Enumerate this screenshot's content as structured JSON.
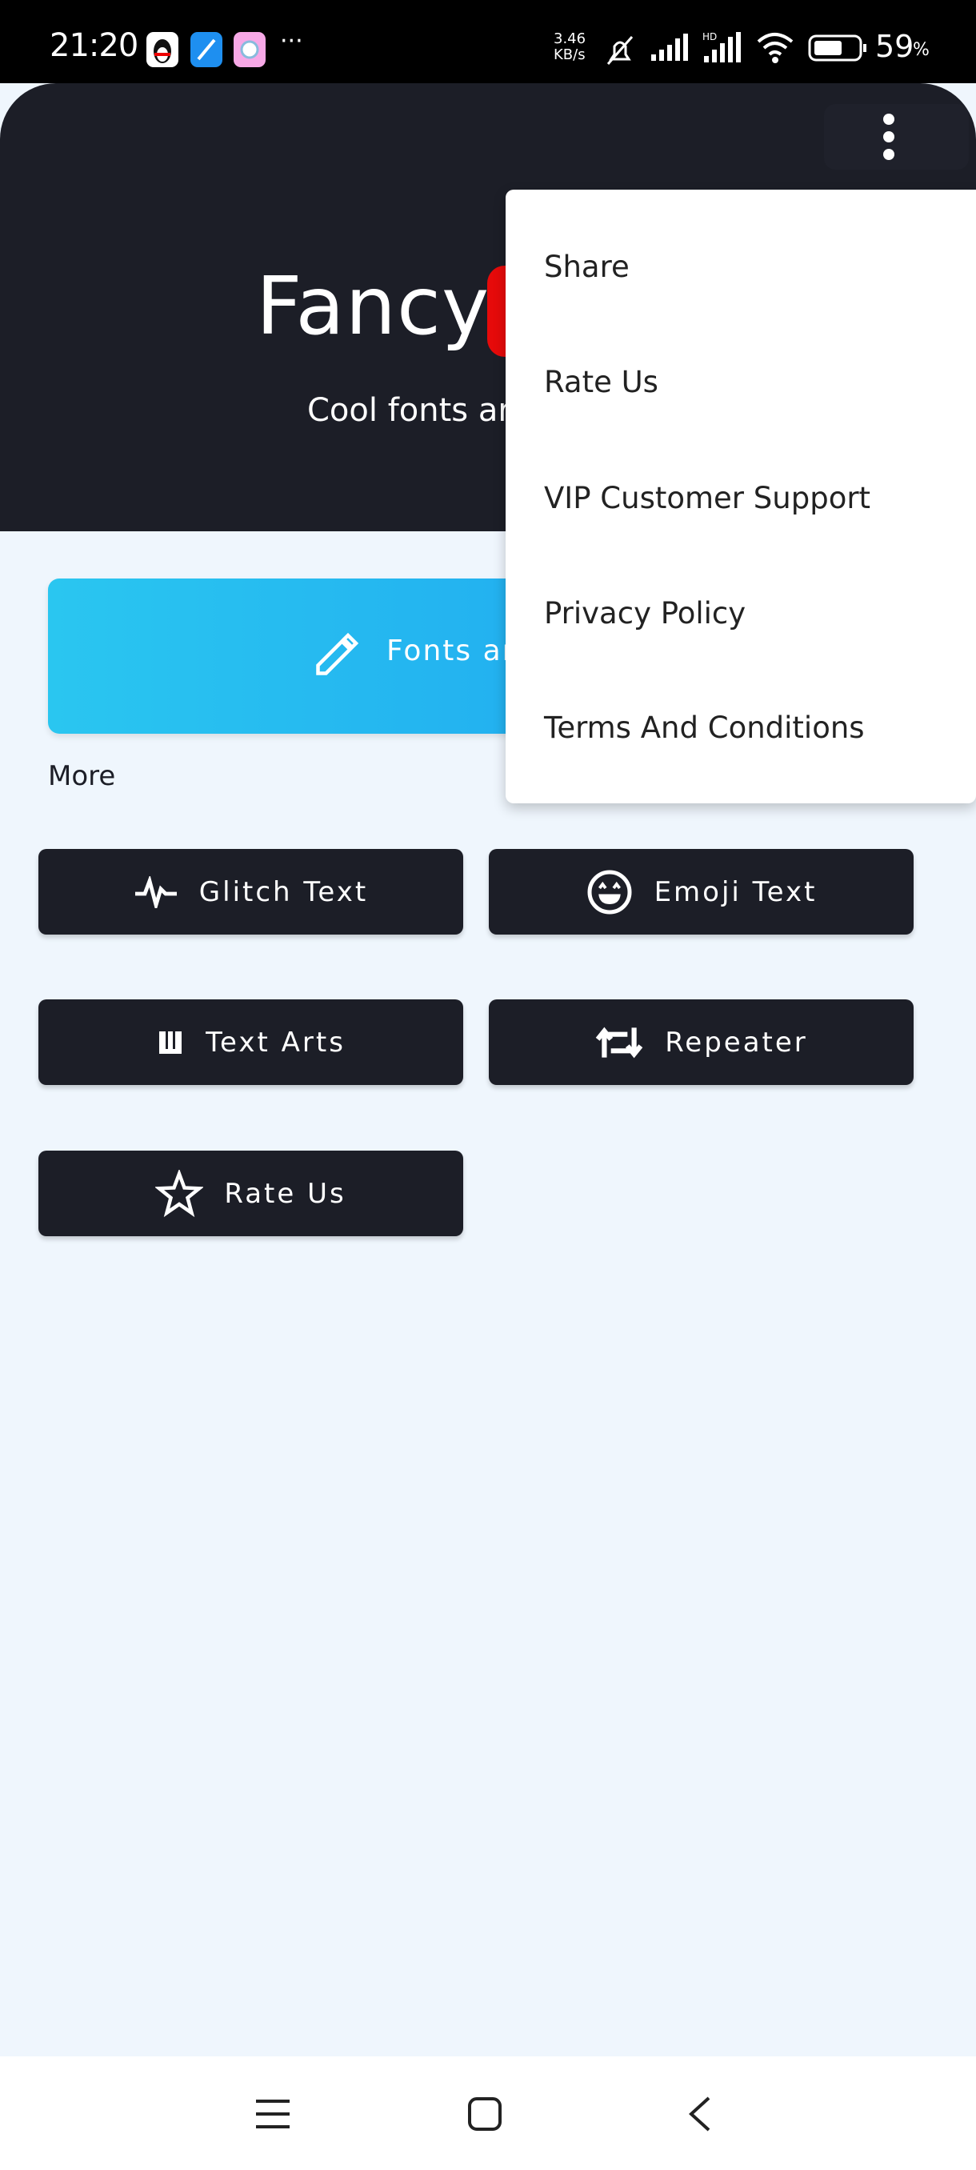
{
  "status_bar": {
    "time": "21:20",
    "more": "···",
    "net_speed_value": "3.46",
    "net_speed_unit": "KB/s",
    "battery": "59",
    "battery_unit": "%"
  },
  "header": {
    "title": "Fancy",
    "subtitle": "Cool fonts ar",
    "menu_icon": "more-vert-icon",
    "accent": "#e60a0a"
  },
  "primary_button": {
    "label": "Fonts ar",
    "icon": "pencil-icon"
  },
  "section_label": "More",
  "buttons": [
    {
      "label": "Glitch Text",
      "icon": "pulse-icon"
    },
    {
      "label": "Emoji Text",
      "icon": "smiley-icon"
    },
    {
      "label": "Text Arts",
      "icon": "w-letter-icon"
    },
    {
      "label": "Repeater",
      "icon": "repeat-icon"
    },
    {
      "label": "Rate Us",
      "icon": "star-icon"
    }
  ],
  "menu": {
    "items": [
      "Share",
      "Rate Us",
      "VIP Customer Support",
      "Privacy Policy",
      "Terms And Conditions"
    ]
  }
}
